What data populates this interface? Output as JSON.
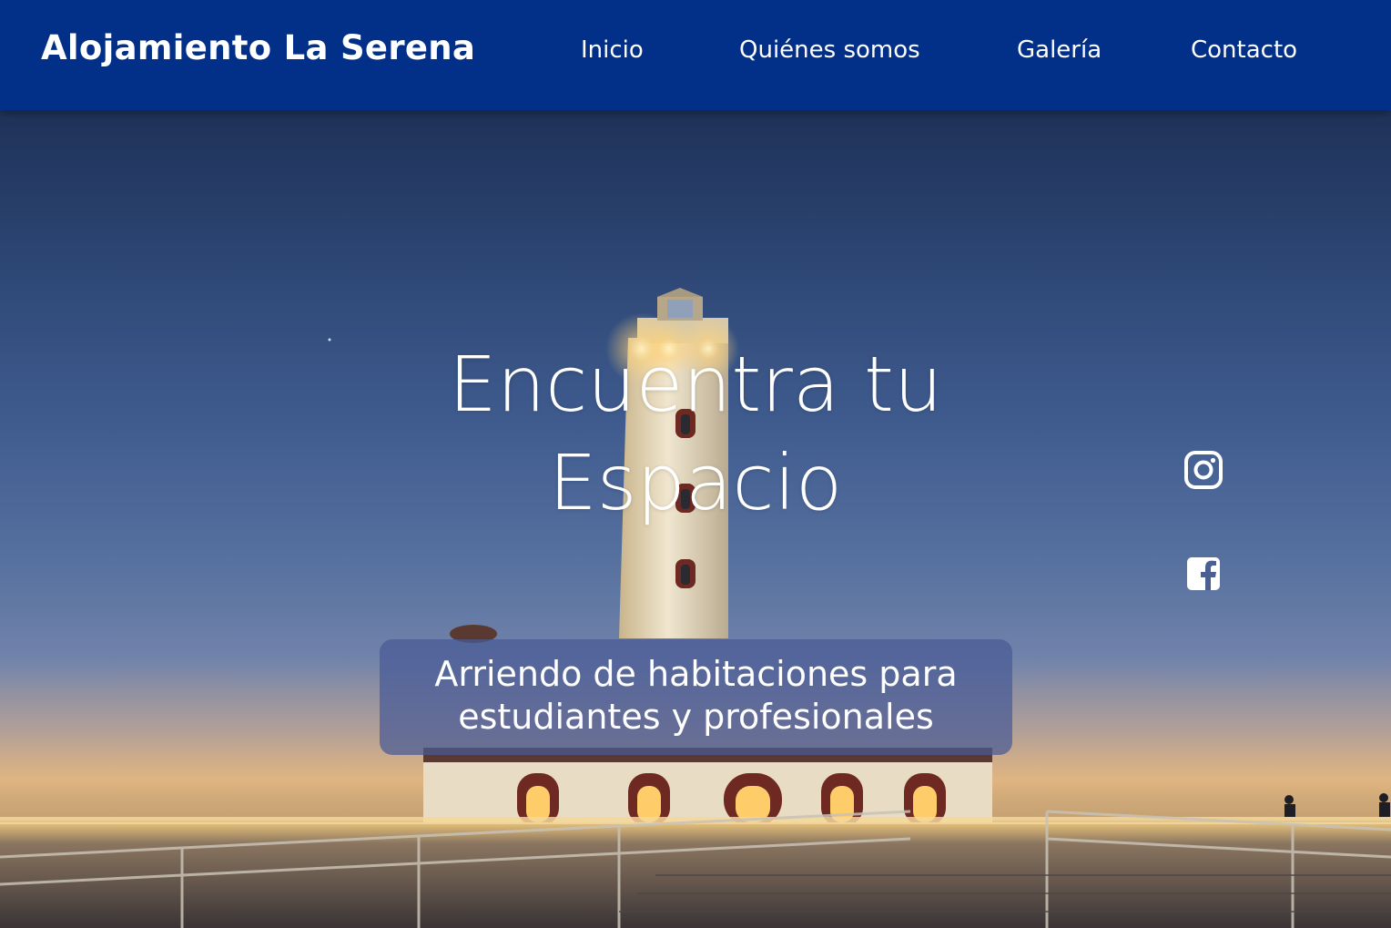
{
  "navbar": {
    "brand": "Alojamiento La Serena",
    "links": [
      {
        "label": "Inicio"
      },
      {
        "label": "Quiénes somos"
      },
      {
        "label": "Galería"
      },
      {
        "label": "Contacto"
      }
    ],
    "background_color": "#022f87"
  },
  "hero": {
    "title_line1": "Encuentra tu",
    "title_line2": "Espacio",
    "subtitle_line1": "Arriendo de habitaciones para",
    "subtitle_line2": "estudiantes y profesionales",
    "background_image": "lighthouse at dusk",
    "social": [
      {
        "icon": "instagram-icon"
      },
      {
        "icon": "facebook-icon"
      }
    ]
  }
}
